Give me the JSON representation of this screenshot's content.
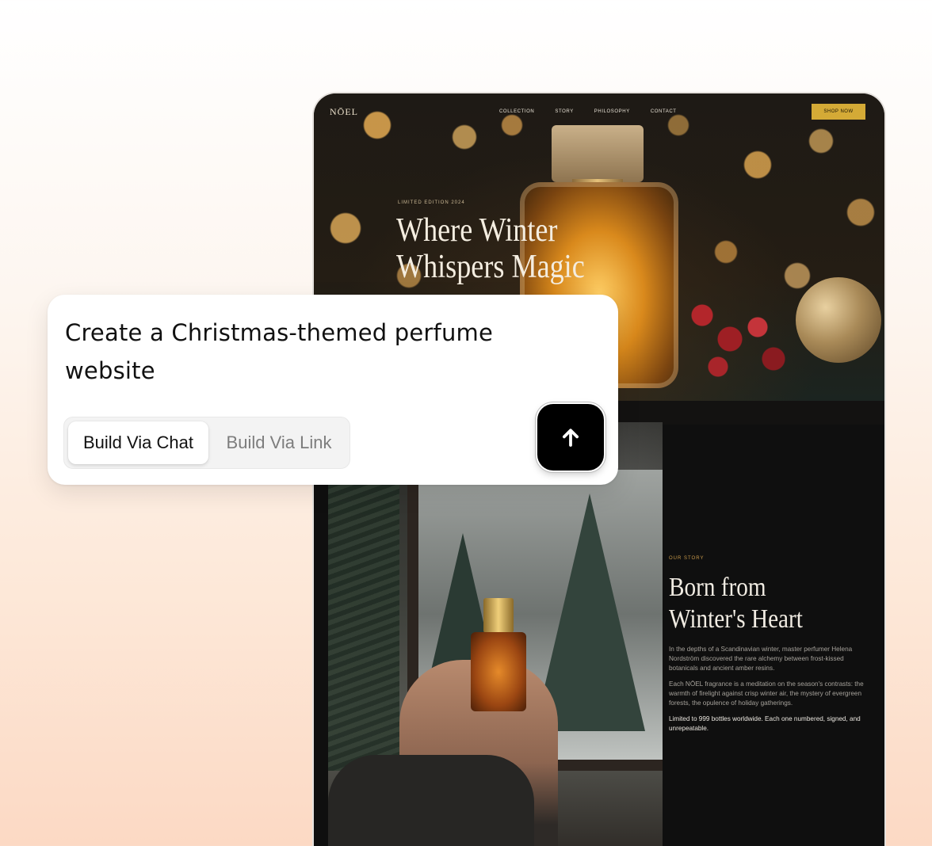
{
  "site": {
    "logo": "NŌEL",
    "nav": [
      "COLLECTION",
      "STORY",
      "PHILOSOPHY",
      "CONTACT"
    ],
    "cta": "SHOP NOW",
    "hero": {
      "kicker": "LIMITED EDITION 2024",
      "title_lines": [
        "Where Winter",
        "Whispers Magic"
      ]
    },
    "story": {
      "kicker": "OUR STORY",
      "title_lines": [
        "Born from",
        "Winter's Heart"
      ],
      "paragraphs": [
        "In the depths of a Scandinavian winter, master perfumer Helena Nordström discovered the rare alchemy between frost-kissed botanicals and ancient amber resins.",
        "Each NŌEL fragrance is a meditation on the season's contrasts: the warmth of firelight against crisp winter air, the mystery of evergreen forests, the opulence of holiday gatherings.",
        "Limited to 999 bottles worldwide. Each one numbered, signed, and unrepeatable."
      ]
    }
  },
  "prompt": {
    "text": "Create a Christmas-themed perfume website",
    "modes": [
      "Build Via Chat",
      "Build Via Link"
    ],
    "active_mode": "Build Via Chat",
    "send_icon": "arrow-up-icon"
  },
  "colors": {
    "accent_gold": "#d4aa36",
    "send_button": "#000000",
    "page_dark": "#0f0f0f"
  }
}
